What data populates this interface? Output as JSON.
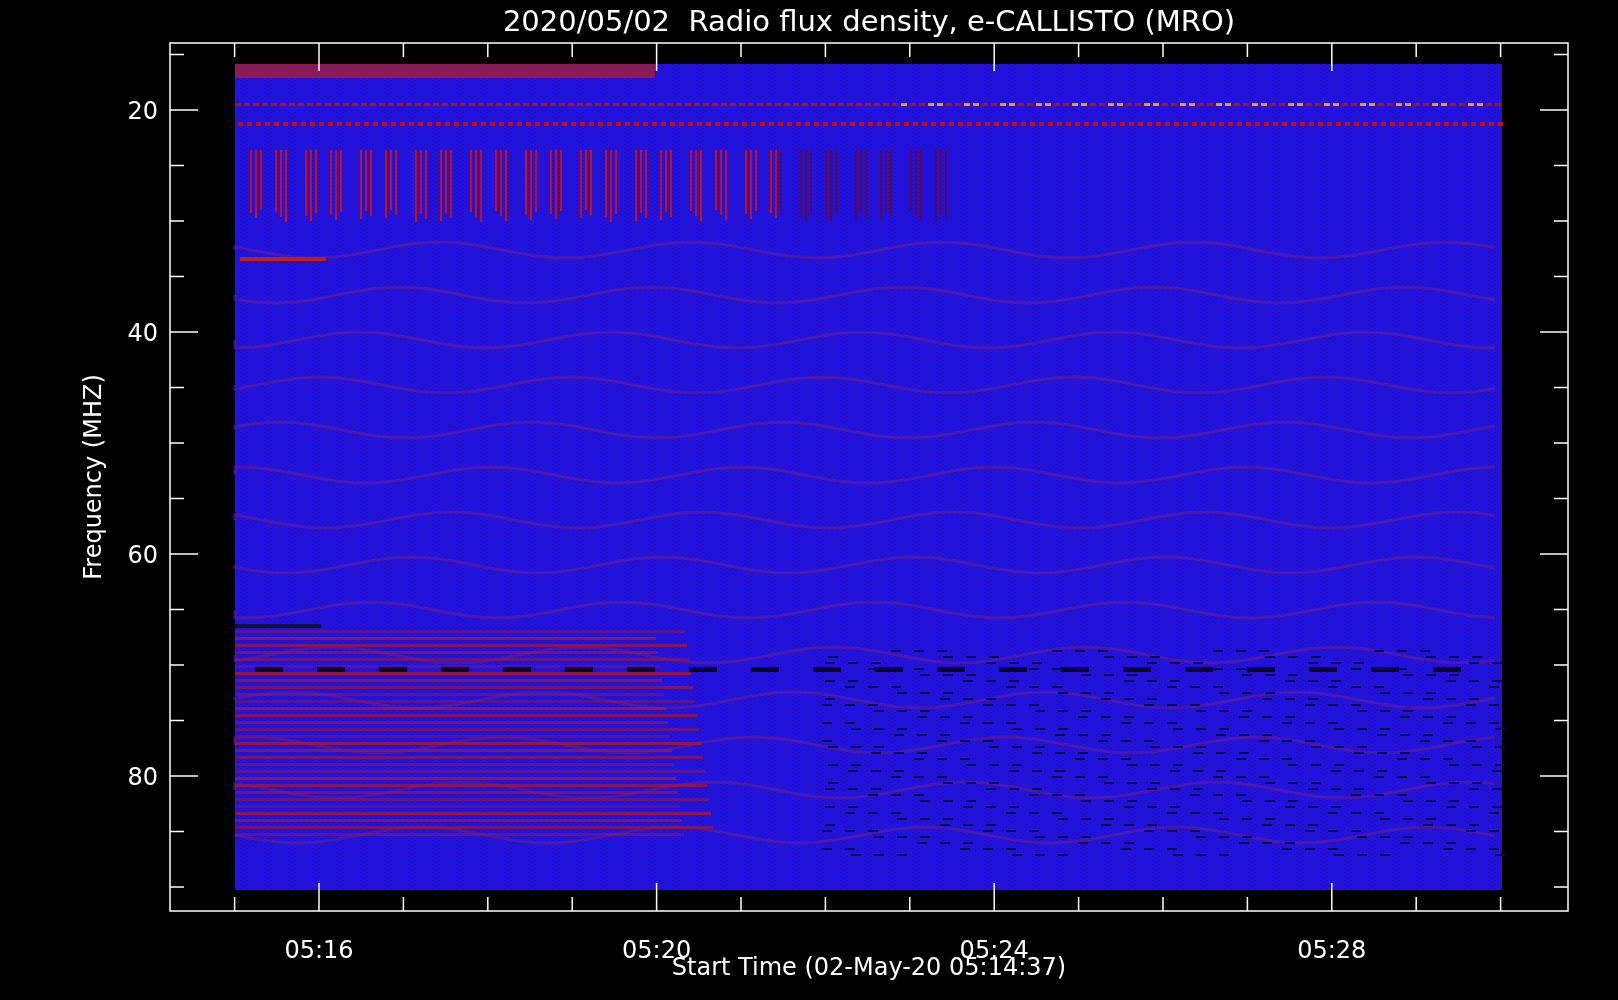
{
  "title": "2020/05/02  Radio flux density, e-CALLISTO (MRO)",
  "y_axis": {
    "label": "Frequency (MHZ)",
    "tick_labels": [
      "20",
      "40",
      "60",
      "80"
    ]
  },
  "x_axis": {
    "label": "Start Time (02-May-20 05:14:37)",
    "tick_labels": [
      "05:16",
      "05:20",
      "05:24",
      "05:28"
    ]
  }
}
